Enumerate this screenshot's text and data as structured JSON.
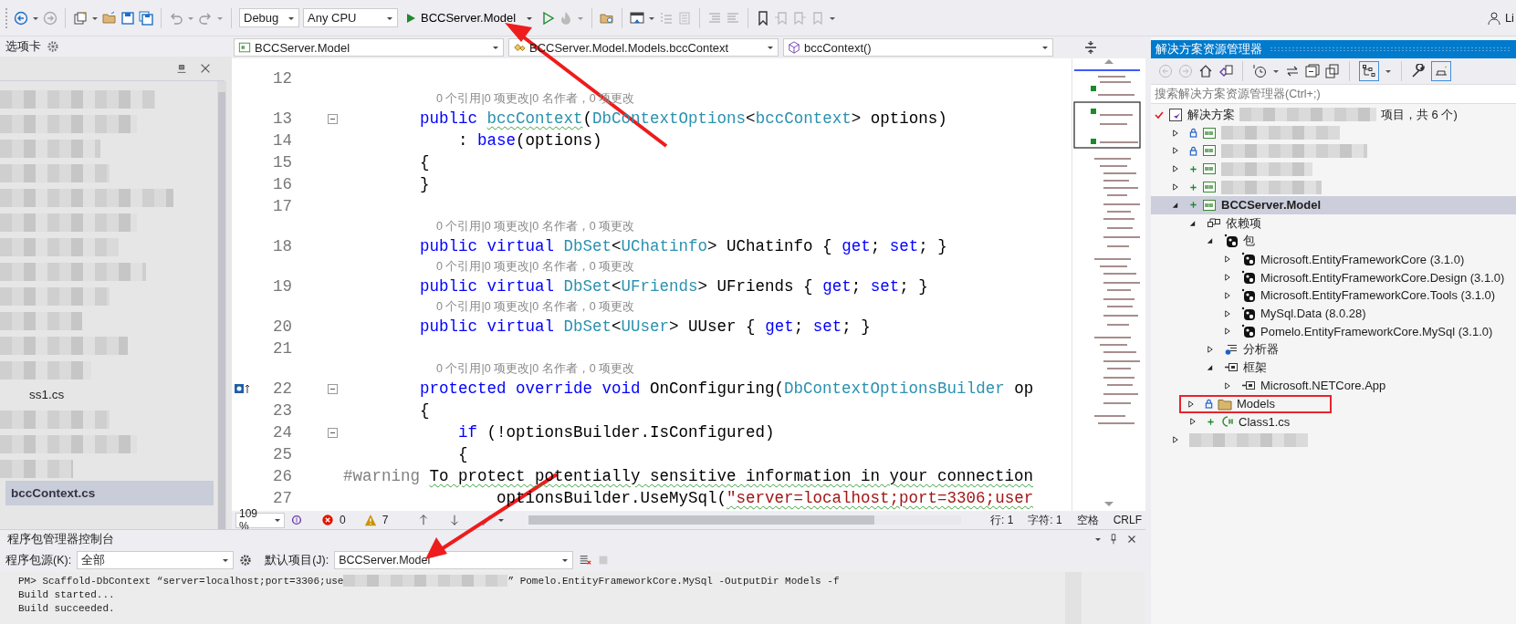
{
  "toolbar": {
    "configuration": "Debug",
    "platform": "Any CPU",
    "startup_project": "BCCServer.Model",
    "startup_annotated": true,
    "cut_label": "Li"
  },
  "tabs_panel": {
    "title": "选项卡",
    "items": [
      {
        "kind": "redacted"
      },
      {
        "kind": "redacted"
      },
      {
        "kind": "redacted"
      },
      {
        "kind": "redacted"
      },
      {
        "kind": "redacted"
      },
      {
        "kind": "redacted"
      },
      {
        "kind": "redacted"
      },
      {
        "kind": "redacted"
      },
      {
        "kind": "redacted"
      },
      {
        "kind": "redacted"
      },
      {
        "kind": "redacted"
      },
      {
        "kind": "redacted"
      },
      {
        "kind": "file",
        "label": "ss1.cs",
        "selected": false
      },
      {
        "kind": "redacted"
      },
      {
        "kind": "redacted"
      },
      {
        "kind": "redacted"
      },
      {
        "kind": "file",
        "label": "bccContext.cs",
        "selected": true
      }
    ]
  },
  "editor": {
    "nav": [
      "BCCServer.Model",
      "BCCServer.Model.Models.bccContext",
      "bccContext()"
    ],
    "lines": [
      {
        "kind": "code",
        "number": "12"
      },
      {
        "kind": "codelens",
        "text": "0 个引用|0 项更改|0 名作者，0 项更改"
      },
      {
        "kind": "code",
        "number": "13",
        "fold": true,
        "tokens": [
          {
            "text": "        public ",
            "kind": "kw"
          },
          {
            "text": "bccContext",
            "kind": "type",
            "squiggle": true
          },
          {
            "text": "(",
            "kind": "plain"
          },
          {
            "text": "DbContextOptions",
            "kind": "type"
          },
          {
            "text": "<",
            "kind": "plain"
          },
          {
            "text": "bccContext",
            "kind": "type"
          },
          {
            "text": "> options)",
            "kind": "plain"
          }
        ]
      },
      {
        "kind": "code",
        "number": "14",
        "tokens": [
          {
            "text": "            : ",
            "kind": "plain"
          },
          {
            "text": "base",
            "kind": "kw"
          },
          {
            "text": "(options)",
            "kind": "plain"
          }
        ]
      },
      {
        "kind": "code",
        "number": "15",
        "tokens": [
          {
            "text": "        {",
            "kind": "plain"
          }
        ]
      },
      {
        "kind": "code",
        "number": "16",
        "tokens": [
          {
            "text": "        }",
            "kind": "plain"
          }
        ]
      },
      {
        "kind": "code",
        "number": "17"
      },
      {
        "kind": "codelens",
        "text": "0 个引用|0 项更改|0 名作者，0 项更改"
      },
      {
        "kind": "code",
        "number": "18",
        "tokens": [
          {
            "text": "        public virtual ",
            "kind": "kw"
          },
          {
            "text": "DbSet",
            "kind": "type"
          },
          {
            "text": "<",
            "kind": "plain"
          },
          {
            "text": "UChatinfo",
            "kind": "type"
          },
          {
            "text": "> UChatinfo { ",
            "kind": "plain"
          },
          {
            "text": "get",
            "kind": "kw"
          },
          {
            "text": "; ",
            "kind": "plain"
          },
          {
            "text": "set",
            "kind": "kw"
          },
          {
            "text": "; }",
            "kind": "plain"
          }
        ]
      },
      {
        "kind": "codelens",
        "text": "0 个引用|0 项更改|0 名作者，0 项更改"
      },
      {
        "kind": "code",
        "number": "19",
        "tokens": [
          {
            "text": "        public virtual ",
            "kind": "kw"
          },
          {
            "text": "DbSet",
            "kind": "type"
          },
          {
            "text": "<",
            "kind": "plain"
          },
          {
            "text": "UFriends",
            "kind": "type"
          },
          {
            "text": "> UFriends { ",
            "kind": "plain"
          },
          {
            "text": "get",
            "kind": "kw"
          },
          {
            "text": "; ",
            "kind": "plain"
          },
          {
            "text": "set",
            "kind": "kw"
          },
          {
            "text": "; }",
            "kind": "plain"
          }
        ]
      },
      {
        "kind": "codelens",
        "text": "0 个引用|0 项更改|0 名作者，0 项更改"
      },
      {
        "kind": "code",
        "number": "20",
        "tokens": [
          {
            "text": "        public virtual ",
            "kind": "kw"
          },
          {
            "text": "DbSet",
            "kind": "type"
          },
          {
            "text": "<",
            "kind": "plain"
          },
          {
            "text": "UUser",
            "kind": "type"
          },
          {
            "text": "> UUser { ",
            "kind": "plain"
          },
          {
            "text": "get",
            "kind": "kw"
          },
          {
            "text": "; ",
            "kind": "plain"
          },
          {
            "text": "set",
            "kind": "kw"
          },
          {
            "text": "; }",
            "kind": "plain"
          }
        ]
      },
      {
        "kind": "code",
        "number": "21"
      },
      {
        "kind": "codelens",
        "text": "0 个引用|0 项更改|0 名作者，0 项更改"
      },
      {
        "kind": "code",
        "number": "22",
        "fold": true,
        "override_marker": true,
        "tokens": [
          {
            "text": "        protected override void ",
            "kind": "kw"
          },
          {
            "text": "OnConfiguring(",
            "kind": "plain"
          },
          {
            "text": "DbContextOptionsBuilder",
            "kind": "type"
          },
          {
            "text": " op",
            "kind": "plain"
          }
        ]
      },
      {
        "kind": "code",
        "number": "23",
        "tokens": [
          {
            "text": "        {",
            "kind": "plain"
          }
        ]
      },
      {
        "kind": "code",
        "number": "24",
        "fold": true,
        "tokens": [
          {
            "text": "            if",
            "kind": "kw"
          },
          {
            "text": " (!optionsBuilder.IsConfigured)",
            "kind": "plain"
          }
        ]
      },
      {
        "kind": "code",
        "number": "25",
        "tokens": [
          {
            "text": "            {",
            "kind": "plain"
          }
        ]
      },
      {
        "kind": "code",
        "number": "26",
        "tokens": [
          {
            "text": "#warning ",
            "kind": "directive"
          },
          {
            "text": "To protect potentially sensitive information in your connection",
            "kind": "plain",
            "squiggle": true
          }
        ]
      },
      {
        "kind": "code",
        "number": "27",
        "tokens": [
          {
            "text": "                optionsBuilder.UseMySql(",
            "kind": "plain"
          },
          {
            "text": "\"server=localhost;port=3306;user",
            "kind": "string",
            "squiggle": true
          }
        ]
      }
    ],
    "status": {
      "zoom": "109 %",
      "errors": "0",
      "warnings": "7",
      "line": "行: 1",
      "char": "字符: 1",
      "indent": "空格",
      "eol": "CRLF"
    }
  },
  "console": {
    "title": "程序包管理器控制台",
    "source_label": "程序包源(K):",
    "source": "全部",
    "project_label": "默认项目(J):",
    "project": "BCCServer.Model",
    "project_annotated": true,
    "output": [
      [
        {
          "kind": "text",
          "text": "PM> Scaffold-DbContext “server=localhost;port=3306;use"
        },
        {
          "kind": "redacted"
        },
        {
          "kind": "text",
          "text": "” Pomelo.EntityFrameworkCore.MySql -OutputDir Models -f"
        }
      ],
      [
        {
          "kind": "text",
          "text": "Build started..."
        }
      ],
      [
        {
          "kind": "text",
          "text": "Build succeeded."
        }
      ]
    ]
  },
  "solution": {
    "title": "解决方案资源管理器",
    "search_placeholder": "搜索解决方案资源管理器(Ctrl+;)",
    "root": {
      "label": "解决方案",
      "label_tail": "项目，共 6 个)"
    },
    "tree": [
      {
        "kind": "project",
        "redacted": true,
        "locked": true,
        "added": false,
        "expanded": false,
        "selected": false
      },
      {
        "kind": "project",
        "redacted": true,
        "locked": true,
        "added": false,
        "expanded": false,
        "selected": false
      },
      {
        "kind": "project",
        "redacted": true,
        "locked": false,
        "added": true,
        "expanded": false,
        "selected": false
      },
      {
        "kind": "project",
        "redacted": true,
        "locked": false,
        "added": true,
        "expanded": false,
        "selected": false
      },
      {
        "kind": "project",
        "label": "BCCServer.Model",
        "locked": false,
        "added": true,
        "expanded": true,
        "selected": true,
        "children": [
          {
            "kind": "dependencies",
            "label": "依赖项",
            "expanded": true,
            "selected": false,
            "children": [
              {
                "kind": "package",
                "label": "包",
                "expanded": true,
                "selected": false,
                "children": [
                  {
                    "kind": "package",
                    "label": "Microsoft.EntityFrameworkCore (3.1.0)",
                    "expanded": false,
                    "selected": false
                  },
                  {
                    "kind": "package",
                    "label": "Microsoft.EntityFrameworkCore.Design (3.1.0)",
                    "expanded": false,
                    "selected": false
                  },
                  {
                    "kind": "package",
                    "label": "Microsoft.EntityFrameworkCore.Tools (3.1.0)",
                    "expanded": false,
                    "selected": false
                  },
                  {
                    "kind": "package",
                    "label": "MySql.Data (8.0.28)",
                    "expanded": false,
                    "selected": false
                  },
                  {
                    "kind": "package",
                    "label": "Pomelo.EntityFrameworkCore.MySql (3.1.0)",
                    "expanded": false,
                    "selected": false
                  }
                ]
              },
              {
                "kind": "analyzer",
                "label": "分析器",
                "expanded": false,
                "selected": false
              },
              {
                "kind": "framework",
                "label": "框架",
                "expanded": true,
                "selected": false,
                "children": [
                  {
                    "kind": "framework",
                    "label": "Microsoft.NETCore.App",
                    "expanded": false,
                    "selected": false
                  }
                ]
              }
            ]
          },
          {
            "kind": "folder",
            "label": "Models",
            "locked": true,
            "added": false,
            "expanded": false,
            "selected": false,
            "highlighted": true
          },
          {
            "kind": "file",
            "label": "Class1.cs",
            "locked": false,
            "added": true,
            "expanded": false,
            "selected": false
          }
        ]
      },
      {
        "kind": "unknown",
        "redacted": true,
        "expanded": false,
        "selected": false
      }
    ]
  }
}
